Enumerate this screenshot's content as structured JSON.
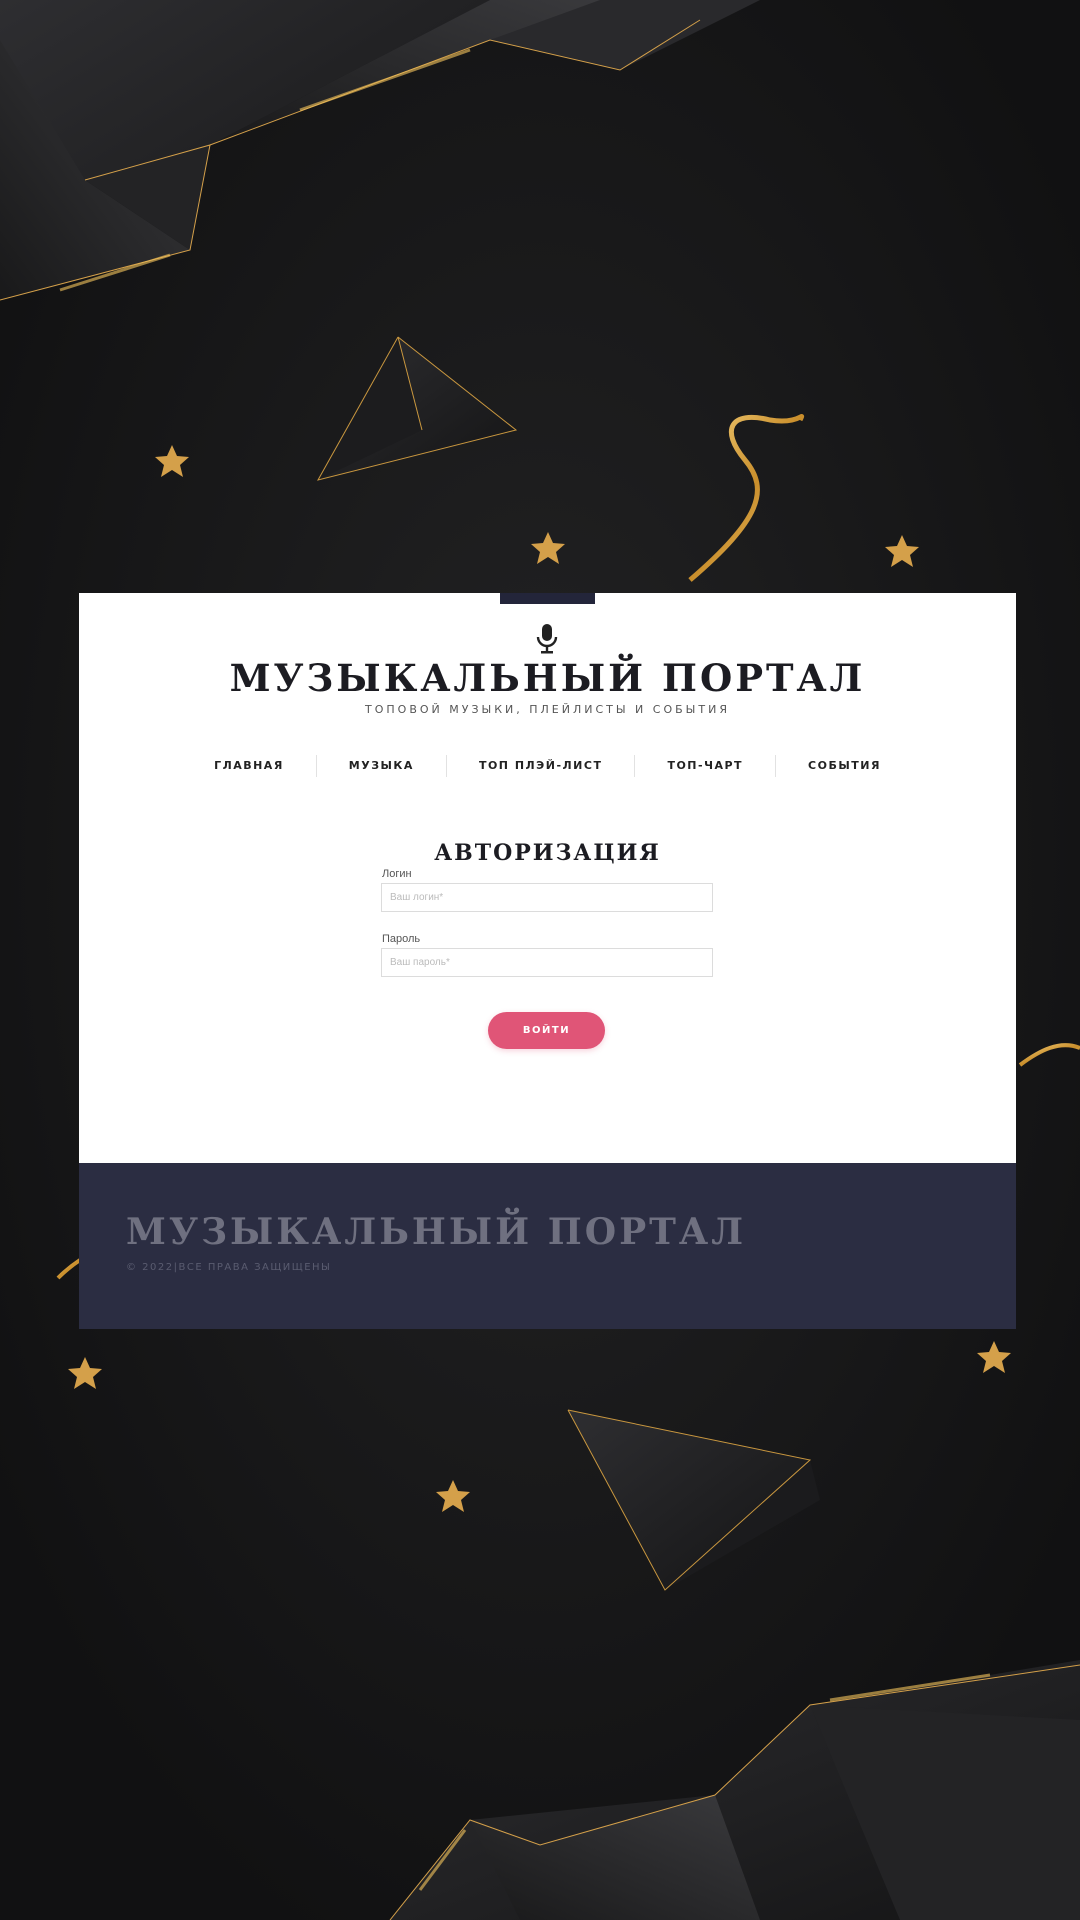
{
  "site": {
    "title": "МУЗЫКАЛЬНЫЙ ПОРТАЛ",
    "subtitle": "ТОПОВОЙ МУЗЫКИ, ПЛЕЙЛИСТЫ И СОБЫТИЯ",
    "logo_icon": "microphone-icon"
  },
  "nav": {
    "items": [
      {
        "label": "ГЛАВНАЯ"
      },
      {
        "label": "МУЗЫКА"
      },
      {
        "label": "ТОП ПЛЭЙ-ЛИСТ"
      },
      {
        "label": "ТОП-ЧАРТ"
      },
      {
        "label": "СОБЫТИЯ"
      }
    ]
  },
  "auth": {
    "title": "АВТОРИЗАЦИЯ",
    "login_label": "Логин",
    "login_placeholder": "Ваш логин*",
    "password_label": "Пароль",
    "password_placeholder": "Ваш пароль*",
    "submit_label": "ВОЙТИ"
  },
  "footer": {
    "title": "МУЗЫКАЛЬНЫЙ ПОРТАЛ",
    "copyright": "© 2022|ВСЕ ПРАВА ЗАЩИЩЕНЫ"
  },
  "colors": {
    "background": "#151516",
    "accent_gold": "#d4a04a",
    "button": "#e05577",
    "footer": "#2b2d42",
    "tab": "#23253a"
  }
}
